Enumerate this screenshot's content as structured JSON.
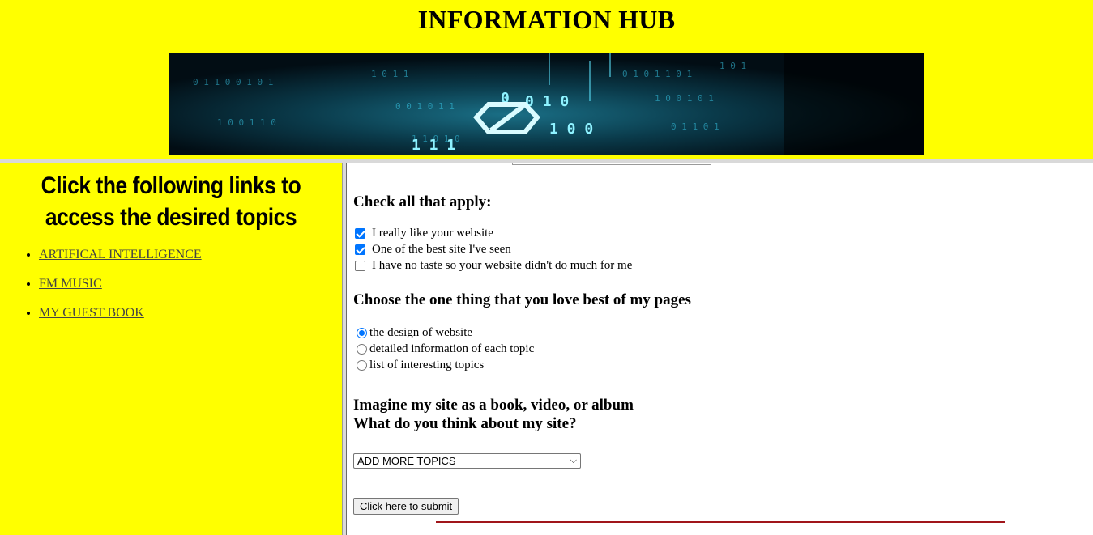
{
  "header": {
    "title": "INFORMATION HUB",
    "banner_image": "digital-data-stream-banner"
  },
  "sidebar": {
    "heading": "Click the following links to access the desired topics",
    "links": [
      {
        "label": "ARTIFICAL INTELLIGENCE"
      },
      {
        "label": "FM MUSIC"
      },
      {
        "label": "MY GUEST BOOK"
      }
    ]
  },
  "form": {
    "checkbox_heading": "Check all that apply:",
    "checkboxes": [
      {
        "label": "I really like your website",
        "checked": true
      },
      {
        "label": "One of the best site I've seen",
        "checked": true
      },
      {
        "label": "I have no taste so your website didn't do much for me",
        "checked": false
      }
    ],
    "radio_heading": "Choose the one thing that you love best of my pages",
    "radios": [
      {
        "label": "the design of website",
        "selected": true
      },
      {
        "label": "detailed information of each topic",
        "selected": false
      },
      {
        "label": "list of interesting topics",
        "selected": false
      }
    ],
    "select_heading_line1": "Imagine my site as a book, video, or album",
    "select_heading_line2": "What do you think about my site?",
    "select_value": "ADD MORE TOPICS",
    "submit_label": "Click here to submit"
  },
  "colors": {
    "page_background": "#ffff00",
    "content_background": "#ffffff",
    "link_color": "#444444",
    "checkbox_accent": "#0075ff",
    "rule_color": "#a0151a"
  }
}
